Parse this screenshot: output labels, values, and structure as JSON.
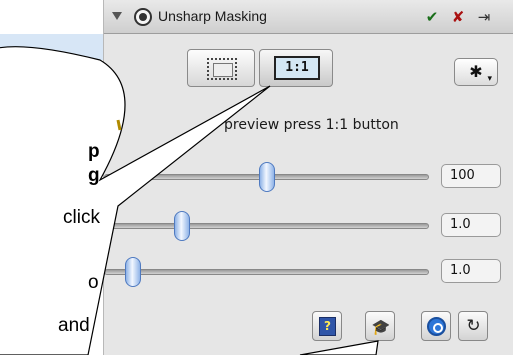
{
  "window": {
    "title": "Unsharp Masking",
    "ok_glyph": "✔",
    "cancel_glyph": "✘",
    "exit_glyph": "⇥"
  },
  "preview": {
    "frame_button_label": "",
    "one_to_one_label": "1:1",
    "gear_glyph": "✱",
    "gear_caret": "▾"
  },
  "hint_text": "preview press 1:1 button",
  "sliders": [
    {
      "value_text": "100",
      "level": 0.5
    },
    {
      "value_text": "1.0",
      "level": 0.24
    },
    {
      "value_text": "1.0",
      "level": 0.09
    }
  ],
  "bottom_icons": [
    {
      "name": "help-icon",
      "glyph": "?"
    },
    {
      "name": "mortarboard-icon",
      "glyph": "🎓"
    },
    {
      "name": "preview-q-icon",
      "glyph": ""
    },
    {
      "name": "refresh-icon",
      "glyph": "↻"
    }
  ],
  "callout": {
    "line1": "p",
    "line2": "g",
    "line3": "click",
    "line4": "o",
    "line5": "and"
  },
  "colors": {
    "panel": "#e6e6e6",
    "blue_tab": "#d7e6f6",
    "knob": "#8fb3e7",
    "one_to_one_fill": "#d4e7f4"
  }
}
